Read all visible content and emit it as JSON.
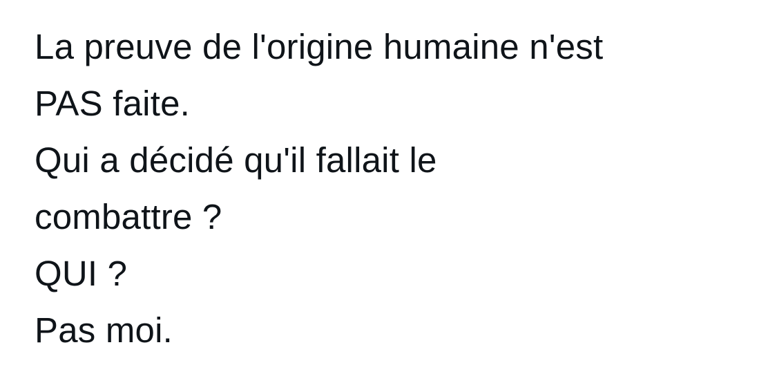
{
  "tweet": {
    "lines": [
      "La preuve de l'origine humaine n'est",
      "PAS faite.",
      "Qui a décidé qu'il fallait le",
      "combattre ?",
      "QUI ?",
      "Pas moi."
    ]
  },
  "colors": {
    "background": "#ffffff",
    "text": "#0f1419"
  }
}
